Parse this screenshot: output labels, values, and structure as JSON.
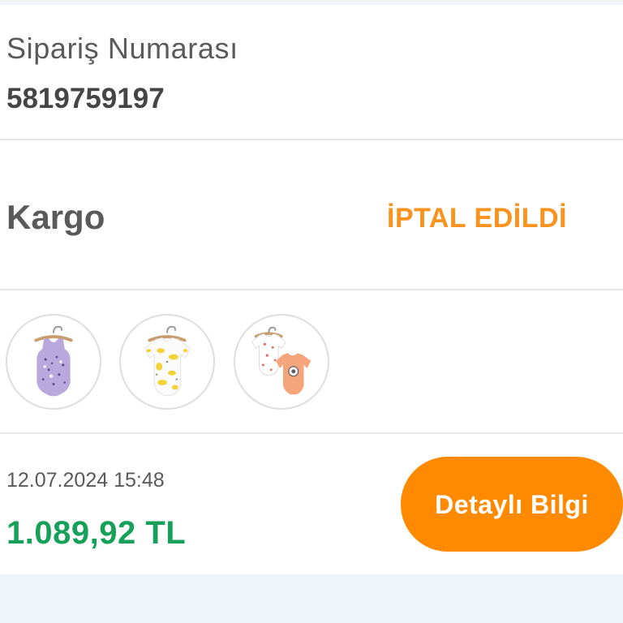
{
  "order": {
    "number_label": "Sipariş Numarası",
    "number": "5819759197"
  },
  "shipping": {
    "label": "Kargo",
    "status": "İPTAL EDİLDİ"
  },
  "products": [
    {
      "icon": "purple-sleeveless-bodysuit-icon",
      "color": "#b9a8de"
    },
    {
      "icon": "giraffe-print-bodysuit-icon",
      "color": "#f3d23a"
    },
    {
      "icon": "two-bodysuit-set-icon",
      "color": "#f6a47c"
    }
  ],
  "summary": {
    "date": "12.07.2024 15:48",
    "total": "1.089,92 TL",
    "details_button": "Detaylı Bilgi"
  },
  "theme": {
    "accent": "#ff8a00",
    "status": "#f7931e",
    "price": "#16a05a",
    "text": "#5a5a5a",
    "strong_text": "#454545",
    "background": "#eef5fb",
    "divider": "#e8e8e8"
  }
}
